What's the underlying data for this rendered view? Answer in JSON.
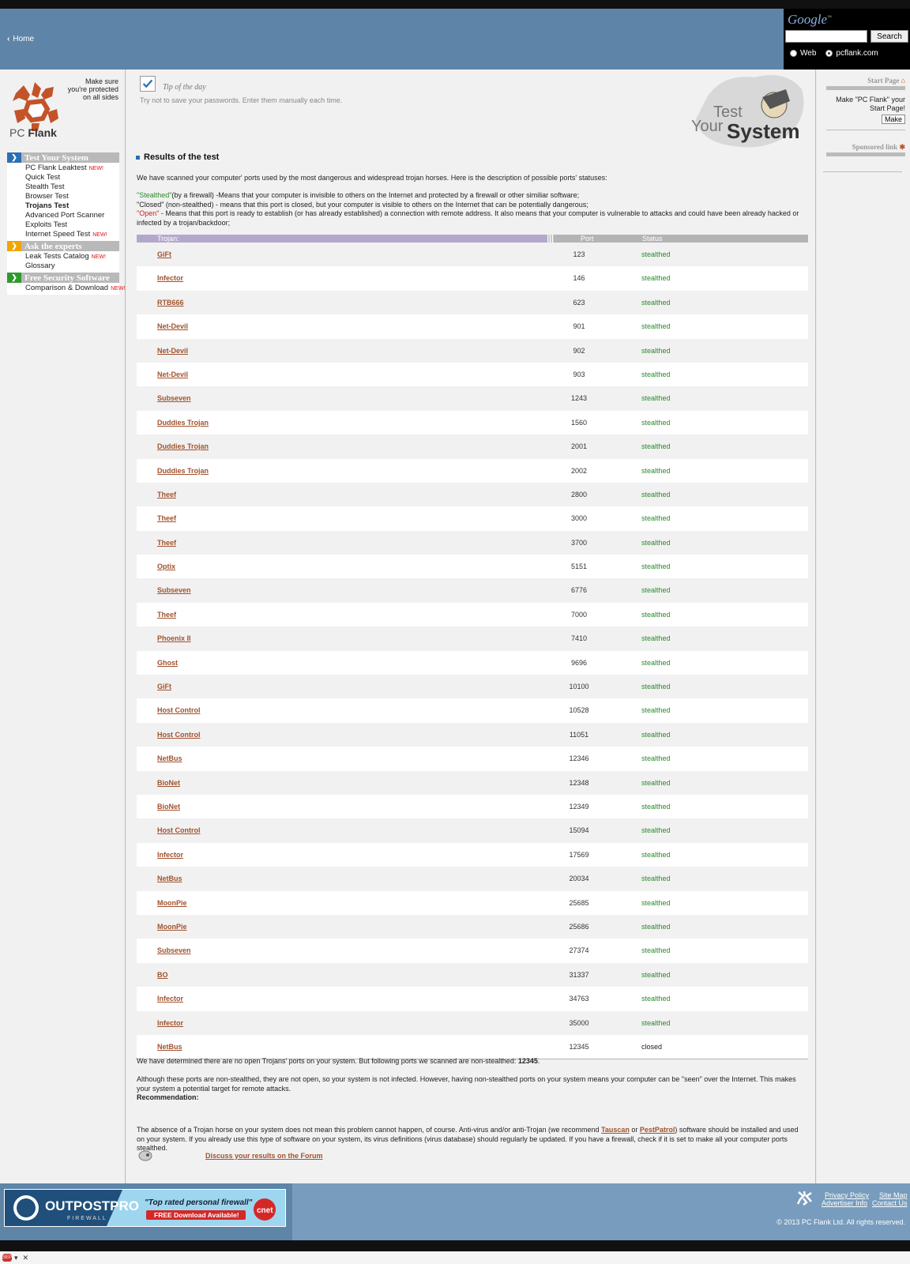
{
  "header": {
    "home_label": "Home"
  },
  "google": {
    "logo": "Google",
    "tm": "™",
    "search_button": "Search",
    "radio_web": "Web",
    "radio_site": "pcflank.com",
    "selected": "pcflank.com",
    "input_value": ""
  },
  "logo": {
    "part1": "PC ",
    "part2": "Flank",
    "tagline_1": "Make sure",
    "tagline_2": "you're protected",
    "tagline_3": "on all sides"
  },
  "nav": {
    "sections": [
      {
        "title": "Test Your System",
        "color": "#2a6fb4",
        "items": [
          {
            "label": "PC Flank Leaktest",
            "new": "NEW!"
          },
          {
            "label": "Quick Test",
            "new": ""
          },
          {
            "label": "Stealth Test",
            "new": ""
          },
          {
            "label": "Browser Test",
            "new": ""
          },
          {
            "label": "Trojans Test",
            "new": "",
            "active": true
          },
          {
            "label": "Advanced Port Scanner",
            "new": ""
          },
          {
            "label": "Exploits Test",
            "new": ""
          },
          {
            "label": "Internet Speed Test",
            "new": "NEW!"
          }
        ]
      },
      {
        "title": "Ask the experts",
        "color": "#f0a500",
        "items": [
          {
            "label": "Leak Tests Catalog",
            "new": "NEW!"
          },
          {
            "label": "Glossary",
            "new": ""
          }
        ]
      },
      {
        "title": "Free Security Software",
        "color": "#2e9a2e",
        "items": [
          {
            "label": "Comparison & Download",
            "new": "NEW!"
          }
        ]
      }
    ]
  },
  "tip": {
    "title": "Tip of the day",
    "text": "Try not to save your passwords. Enter them manually each time."
  },
  "tys": {
    "test": "Test",
    "your": "Your",
    "system": "System"
  },
  "results": {
    "title": "Results of the test",
    "intro": "We have scanned your computer' ports used by the most dangerous and widespread trojan horses. Here is the description of possible ports' statuses:",
    "stealthed_word": "\"Stealthed\"",
    "stealthed_desc": "(by a firewall) -Means that your computer is invisible to others on the Internet and protected by a firewall or other similiar software;",
    "closed_word": "\"Closed\"",
    "closed_desc": " (non-stealthed) - means that this port is closed, but your computer is visible to others on the Internet that can be potentially dangerous;",
    "open_word": "\"Open\"",
    "open_desc": " - Means that this port is ready to establish (or has already established) a connection with remote address. It also means that your computer is vulnerable to attacks and could have been already hacked or infected by a trojan/backdoor;",
    "col_trojan": "Trojan:",
    "col_port": "Port",
    "col_status": "Status",
    "rows": [
      {
        "trojan": "GiFt",
        "port": "123",
        "status": "stealthed"
      },
      {
        "trojan": "Infector",
        "port": "146",
        "status": "stealthed"
      },
      {
        "trojan": "RTB666",
        "port": "623",
        "status": "stealthed"
      },
      {
        "trojan": "Net-Devil",
        "port": "901",
        "status": "stealthed"
      },
      {
        "trojan": "Net-Devil",
        "port": "902",
        "status": "stealthed"
      },
      {
        "trojan": "Net-Devil",
        "port": "903",
        "status": "stealthed"
      },
      {
        "trojan": "Subseven",
        "port": "1243",
        "status": "stealthed"
      },
      {
        "trojan": "Duddies Trojan",
        "port": "1560",
        "status": "stealthed"
      },
      {
        "trojan": "Duddies Trojan",
        "port": "2001",
        "status": "stealthed"
      },
      {
        "trojan": "Duddies Trojan",
        "port": "2002",
        "status": "stealthed"
      },
      {
        "trojan": "Theef",
        "port": "2800",
        "status": "stealthed"
      },
      {
        "trojan": "Theef",
        "port": "3000",
        "status": "stealthed"
      },
      {
        "trojan": "Theef",
        "port": "3700",
        "status": "stealthed"
      },
      {
        "trojan": "Optix",
        "port": "5151",
        "status": "stealthed"
      },
      {
        "trojan": "Subseven",
        "port": "6776",
        "status": "stealthed"
      },
      {
        "trojan": "Theef",
        "port": "7000",
        "status": "stealthed"
      },
      {
        "trojan": "Phoenix II",
        "port": "7410",
        "status": "stealthed"
      },
      {
        "trojan": "Ghost",
        "port": "9696",
        "status": "stealthed"
      },
      {
        "trojan": "GiFt",
        "port": "10100",
        "status": "stealthed"
      },
      {
        "trojan": "Host Control",
        "port": "10528",
        "status": "stealthed"
      },
      {
        "trojan": "Host Control",
        "port": "11051",
        "status": "stealthed"
      },
      {
        "trojan": "NetBus",
        "port": "12346",
        "status": "stealthed"
      },
      {
        "trojan": "BioNet",
        "port": "12348",
        "status": "stealthed"
      },
      {
        "trojan": "BioNet",
        "port": "12349",
        "status": "stealthed"
      },
      {
        "trojan": "Host Control",
        "port": "15094",
        "status": "stealthed"
      },
      {
        "trojan": "Infector",
        "port": "17569",
        "status": "stealthed"
      },
      {
        "trojan": "NetBus",
        "port": "20034",
        "status": "stealthed"
      },
      {
        "trojan": "MoonPie",
        "port": "25685",
        "status": "stealthed"
      },
      {
        "trojan": "MoonPie",
        "port": "25686",
        "status": "stealthed"
      },
      {
        "trojan": "Subseven",
        "port": "27374",
        "status": "stealthed"
      },
      {
        "trojan": "BO",
        "port": "31337",
        "status": "stealthed"
      },
      {
        "trojan": "Infector",
        "port": "34763",
        "status": "stealthed"
      },
      {
        "trojan": "Infector",
        "port": "35000",
        "status": "stealthed"
      },
      {
        "trojan": "NetBus",
        "port": "12345",
        "status": "closed"
      }
    ],
    "status_colors": {
      "stealthed": "#2a8a2a",
      "closed": "#222222"
    },
    "summary_prefix": "We have determined there are no open Trojans' ports on your system. But following ports we scanned are non-stealthed: ",
    "summary_ports": "12345",
    "summary_suffix": ".",
    "explain": "Although these ports are non-stealthed, they are not open, so your system is not infected. However, having non-stealthed ports on your system means your computer can be \"seen\" over the Internet. This makes your system a potential target for remote attacks.",
    "recommendation_title": "Recommendation:",
    "rec_1": "The absence of a Trojan horse on your system does not mean this problem cannot happen, of course. Anti-virus and/or anti-Trojan (we recommend ",
    "rec_link1": "Tauscan",
    "rec_or": " or ",
    "rec_link2": "PestPatrol",
    "rec_2": ") software should be installed and used on your system. If you already use this type of software on your system, its virus definitions (virus database) should regularly be updated. If you have a firewall, check if it is set to make all your computer ports stealthed.",
    "discuss": "Discuss your results on the Forum"
  },
  "right": {
    "start_title": "Start Page",
    "start_text": "Make \"PC Flank\" your Start Page!",
    "make_button": "Make",
    "sponsored_title": "Sponsored link"
  },
  "footer": {
    "banner_brand": "OUTPOSTPRO",
    "banner_sub": "FIREWALL",
    "banner_quote": "\"Top rated personal firewall\"",
    "banner_cta": "FREE Download Available!",
    "banner_badge": "cnet",
    "privacy": "Privacy Policy",
    "advertiser": "Advertiser Info",
    "sitemap": "Site Map",
    "contact": "Contact Us",
    "copyright": "© 2013 PC Flank Ltd. All rights reserved."
  },
  "statusbar": {
    "icon": "SEP",
    "close": "✕"
  }
}
